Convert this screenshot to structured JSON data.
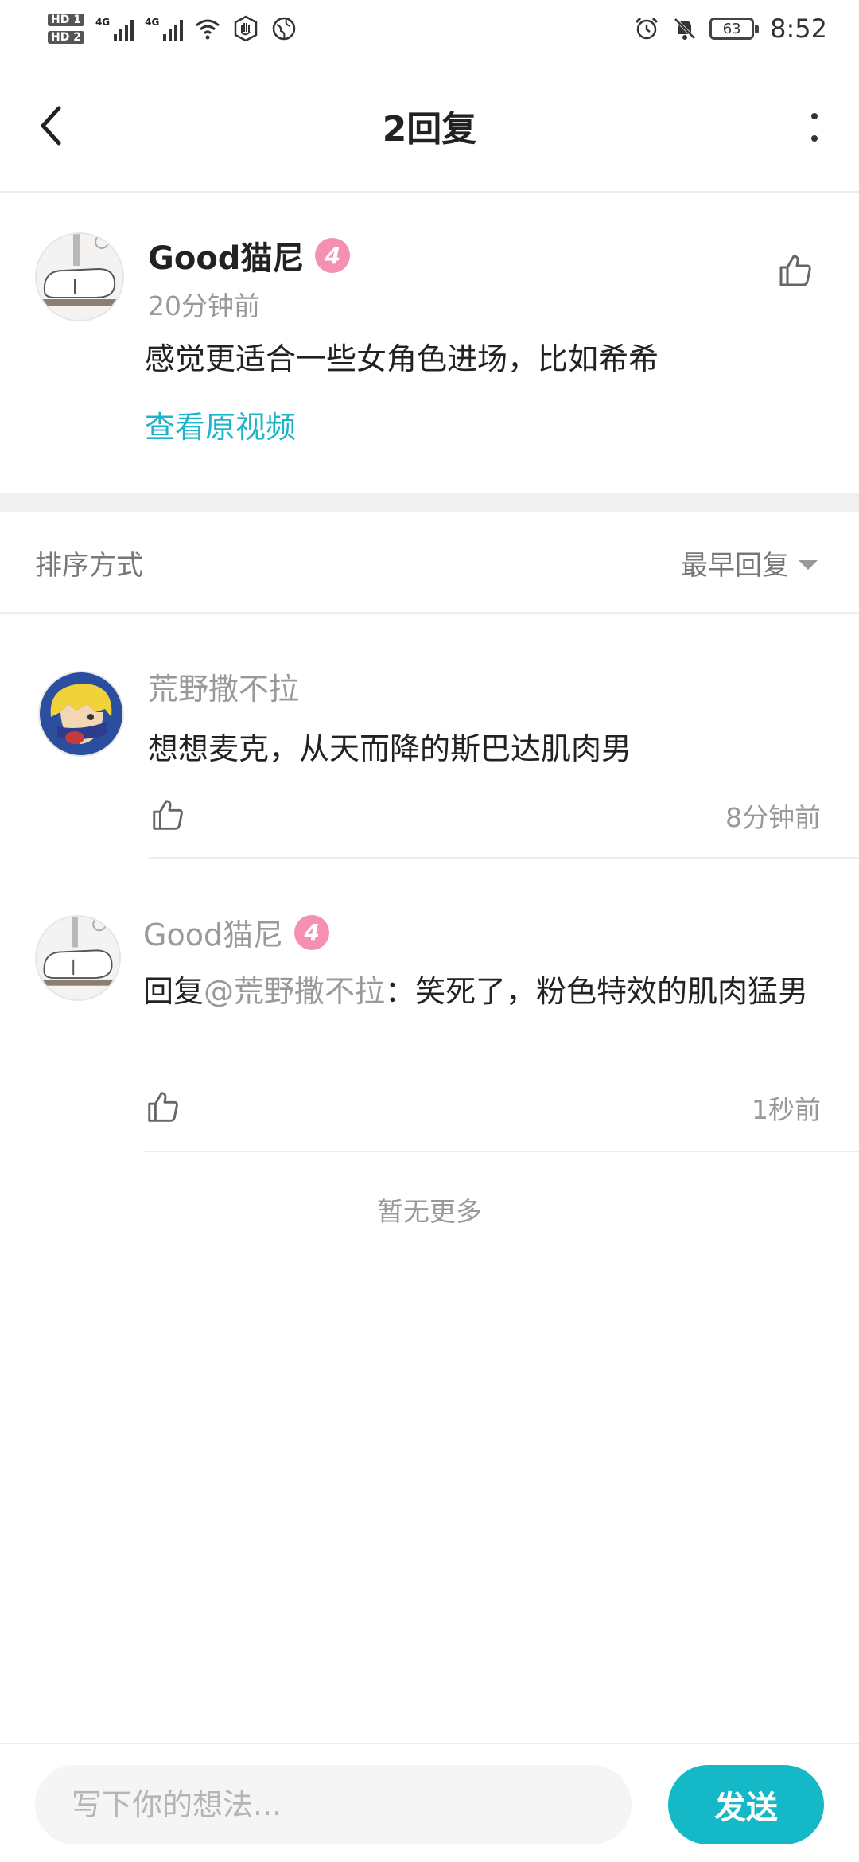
{
  "status_bar": {
    "hd1": "HD 1",
    "hd2": "HD 2",
    "net1": "4G",
    "net2": "4G",
    "battery": "63",
    "time": "8:52"
  },
  "header": {
    "title": "2回复"
  },
  "main_comment": {
    "author": "Good猫尼",
    "level": "4",
    "time": "20分钟前",
    "text": "感觉更适合一些女角色进场，比如希希",
    "link": "查看原视频"
  },
  "sort": {
    "label": "排序方式",
    "selected": "最早回复"
  },
  "replies": [
    {
      "author": "荒野撒不拉",
      "text": "想想麦克，从天而降的斯巴达肌肉男",
      "time": "8分钟前"
    },
    {
      "author": "Good猫尼",
      "level": "4",
      "prefix": "回复",
      "mention": "@荒野撒不拉",
      "text_after": "：笑死了，粉色特效的肌肉猛男",
      "time": "1秒前"
    }
  ],
  "footer_note": "暂无更多",
  "composer": {
    "placeholder": "写下你的想法...",
    "send_label": "发送"
  },
  "colors": {
    "accent": "#14b8c6",
    "link": "#1db4c8",
    "level_badge": "#f590b2"
  }
}
